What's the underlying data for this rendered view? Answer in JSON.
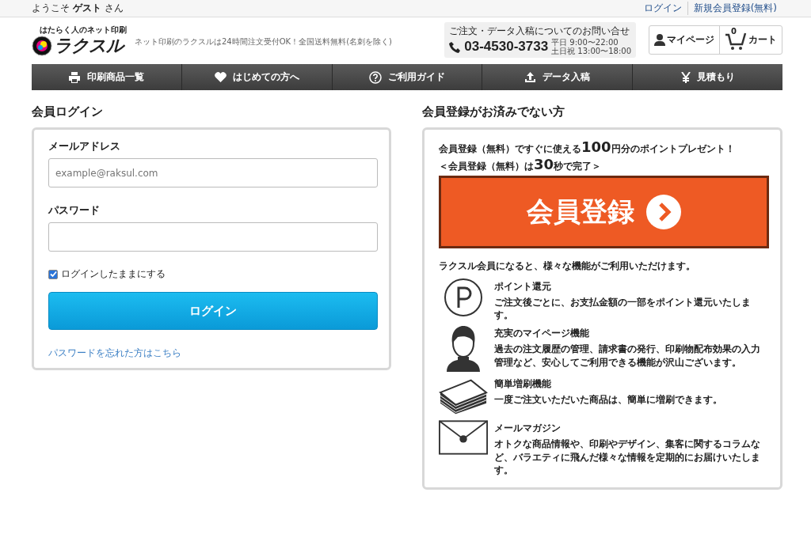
{
  "top_bar": {
    "welcome": "ようこそ **ゲスト** さん",
    "links": [
      "ログイン",
      "新規会員登録(無料)"
    ]
  },
  "header": {
    "logo_tagline": "はたらく人のネット印刷",
    "logo_name": "ラクスル",
    "catch": "ネット印刷のラクスルは24時間注文受付OK！全国送料無料(名刺を除く)",
    "contact": {
      "label": "ご注文・データ入稿についてのお問い合せ",
      "phone": "03-4530-3733",
      "hours": [
        "平日 9:00〜22:00",
        "土日祝 13:00〜18:00"
      ]
    },
    "mypage": "マイページ",
    "cart": {
      "label": "カート",
      "count": "0"
    }
  },
  "nav": [
    "印刷商品一覧",
    "はじめての方へ",
    "ご利用ガイド",
    "データ入稿",
    "見積もり"
  ],
  "login": {
    "title": "会員ログイン",
    "email_label": "メールアドレス",
    "email_placeholder": "example@raksul.com",
    "password_label": "パスワード",
    "remember": {
      "label": "ログインしたままにする",
      "checked": true
    },
    "button": "ログイン",
    "forgot": "パスワードを忘れた方はこちら"
  },
  "register": {
    "title": "会員登録がお済みでない方",
    "promo": [
      [
        {
          "text": "会員登録（無料）ですぐに使える",
          "big": false
        },
        {
          "text": "100",
          "big": true
        },
        {
          "text": "円分のポイントプレゼント！",
          "big": false
        }
      ],
      [
        {
          "text": "＜会員登録（無料）は",
          "big": false
        },
        {
          "text": "30",
          "big": true
        },
        {
          "text": "秒で完了＞",
          "big": false
        }
      ]
    ],
    "button": "会員登録",
    "lead": "ラクスル会員になると、様々な機能がご利用いただけます。",
    "features": [
      {
        "title": "ポイント還元",
        "text": "ご注文後ごとに、お支払金額の一部をポイント還元いたします。"
      },
      {
        "title": "充実のマイページ機能",
        "text": "過去の注文履歴の管理、請求書の発行、印刷物配布効果の入力管理など、安心してご利用できる機能が沢山ございます。"
      },
      {
        "title": "簡単増刷機能",
        "text": "一度ご注文いただいた商品は、簡単に増刷できます。"
      },
      {
        "title": "メールマガジン",
        "text": "オトクな商品情報や、印刷やデザイン、集客に関するコラムなど、バラエティに飛んだ様々な情報を定期的にお届けいたします。"
      }
    ]
  }
}
